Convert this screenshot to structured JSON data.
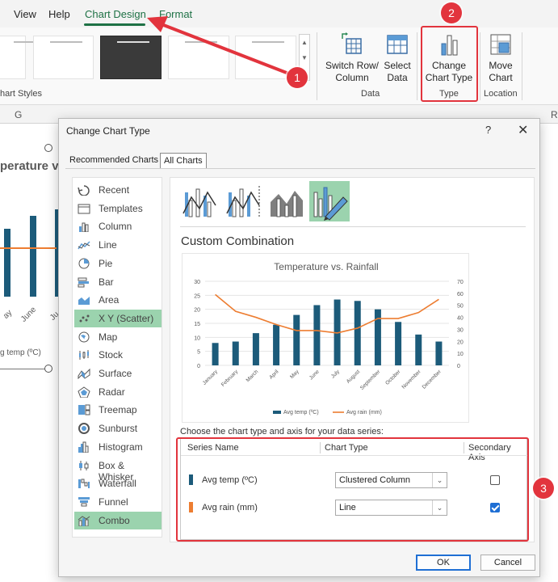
{
  "menu": {
    "view": "View",
    "help": "Help",
    "chart_design": "Chart Design",
    "format": "Format"
  },
  "ribbon": {
    "chart_styles_label": "hart Styles",
    "switch_row_col": [
      "Switch Row/",
      "Column"
    ],
    "select_data": [
      "Select",
      "Data"
    ],
    "data_group_label": "Data",
    "change_chart_type": [
      "Change",
      "Chart Type"
    ],
    "type_group_label": "Type",
    "move_chart": [
      "Move",
      "Chart"
    ],
    "location_group_label": "Location"
  },
  "badges": {
    "b1": "1",
    "b2": "2",
    "b3": "3"
  },
  "sheet": {
    "col_g": "G",
    "col_r": "R",
    "bg_chart_title": "perature v",
    "bg_labels": [
      "ay",
      "June",
      "Ju"
    ],
    "bg_legend": "g temp (ºC)"
  },
  "dialog": {
    "title": "Change Chart Type",
    "help": "?",
    "close": "✕",
    "tabs": [
      "Recommended Charts",
      "All Charts"
    ],
    "chart_types": [
      {
        "label": "Recent",
        "icon": "recent-icon"
      },
      {
        "label": "Templates",
        "icon": "templates-icon"
      },
      {
        "label": "Column",
        "icon": "column-icon"
      },
      {
        "label": "Line",
        "icon": "line-icon"
      },
      {
        "label": "Pie",
        "icon": "pie-icon"
      },
      {
        "label": "Bar",
        "icon": "bar-icon"
      },
      {
        "label": "Area",
        "icon": "area-icon"
      },
      {
        "label": "X Y (Scatter)",
        "icon": "scatter-icon"
      },
      {
        "label": "Map",
        "icon": "map-icon"
      },
      {
        "label": "Stock",
        "icon": "stock-icon"
      },
      {
        "label": "Surface",
        "icon": "surface-icon"
      },
      {
        "label": "Radar",
        "icon": "radar-icon"
      },
      {
        "label": "Treemap",
        "icon": "treemap-icon"
      },
      {
        "label": "Sunburst",
        "icon": "sunburst-icon"
      },
      {
        "label": "Histogram",
        "icon": "histogram-icon"
      },
      {
        "label": "Box & Whisker",
        "icon": "box-whisker-icon"
      },
      {
        "label": "Waterfall",
        "icon": "waterfall-icon"
      },
      {
        "label": "Funnel",
        "icon": "funnel-icon"
      },
      {
        "label": "Combo",
        "icon": "combo-icon"
      }
    ],
    "selected_indices": [
      7,
      18
    ],
    "custom_title": "Custom Combination",
    "choose_label": "Choose the chart type and axis for your data series:",
    "series_headers": [
      "Series Name",
      "Chart Type",
      "Secondary Axis"
    ],
    "series": [
      {
        "name": "Avg temp (ºC)",
        "color": "#1c5b7a",
        "chart_type": "Clustered Column",
        "secondary": false
      },
      {
        "name": "Avg rain (mm)",
        "color": "#ed7d31",
        "chart_type": "Line",
        "secondary": true
      }
    ],
    "ok": "OK",
    "cancel": "Cancel"
  },
  "chart_data": {
    "type": "bar",
    "title": "Temperature vs. Rainfall",
    "categories": [
      "January",
      "February",
      "March",
      "April",
      "May",
      "June",
      "July",
      "August",
      "September",
      "October",
      "November",
      "December"
    ],
    "series": [
      {
        "name": "Avg temp (ºC)",
        "type": "bar",
        "axis": "primary",
        "color": "#1c5b7a",
        "values": [
          8,
          8.5,
          11.5,
          14.5,
          18,
          21.5,
          23.5,
          23,
          20,
          15.5,
          11,
          8.5
        ]
      },
      {
        "name": "Avg rain (mm)",
        "type": "line",
        "axis": "secondary",
        "color": "#ed7d31",
        "values": [
          59,
          45,
          40,
          34,
          29,
          29,
          27,
          31,
          39,
          39,
          44,
          55
        ]
      }
    ],
    "ylim": [
      0,
      30
    ],
    "y_ticks": [
      "0",
      "5",
      "10",
      "15",
      "20",
      "25",
      "30"
    ],
    "y2lim": [
      0,
      70
    ],
    "y2_ticks": [
      "0",
      "10",
      "20",
      "30",
      "40",
      "50",
      "60",
      "70"
    ],
    "grid": true,
    "legend": "bottom",
    "legend_entries": [
      "Avg temp (ºC)",
      "Avg rain (mm)"
    ]
  }
}
